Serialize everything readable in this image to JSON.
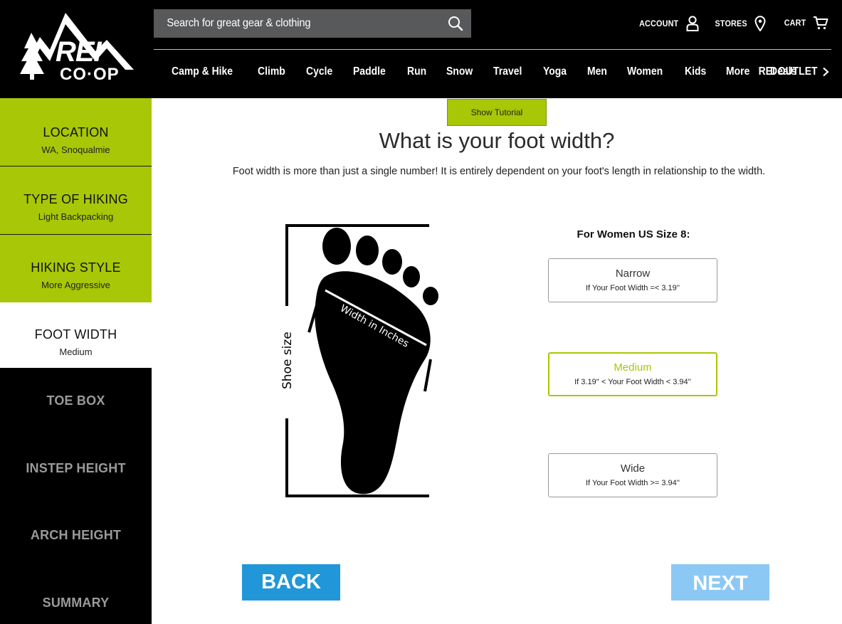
{
  "header": {
    "logo_text_top": "REI",
    "logo_text_bottom": "CO·OP",
    "search_placeholder": "Search for great gear & clothing",
    "account_label": "ACCOUNT",
    "stores_label": "STORES",
    "cart_label": "CART",
    "nav": [
      "Camp & Hike",
      "Climb",
      "Cycle",
      "Paddle",
      "Run",
      "Snow",
      "Travel",
      "Yoga",
      "Men",
      "Women",
      "Kids",
      "More",
      "Deals"
    ],
    "outlet_label": "REI OUTLET"
  },
  "sidebar": {
    "steps": [
      {
        "title": "LOCATION",
        "value": "WA, Snoqualmie",
        "state": "done"
      },
      {
        "title": "TYPE OF HIKING",
        "value": "Light Backpacking",
        "state": "done"
      },
      {
        "title": "HIKING STYLE",
        "value": "More Aggressive",
        "state": "done"
      },
      {
        "title": "FOOT WIDTH",
        "value": "Medium",
        "state": "active"
      },
      {
        "title": "TOE BOX",
        "value": "",
        "state": "future"
      },
      {
        "title": "INSTEP HEIGHT",
        "value": "",
        "state": "future"
      },
      {
        "title": "ARCH HEIGHT",
        "value": "",
        "state": "future"
      },
      {
        "title": "SUMMARY",
        "value": "",
        "state": "future"
      }
    ]
  },
  "main": {
    "tutorial_label": "Show Tutorial",
    "question": "What is your foot width?",
    "subtext": "Foot width is more than just a single number! It is entirely dependent on your foot's length in relationship to the width.",
    "diagram": {
      "width_label": "Width in Inches",
      "length_label": "Shoe size"
    },
    "size_label": "For Women US Size 8:",
    "options": [
      {
        "name": "Narrow",
        "range": "If Your Foot Width =< 3.19''",
        "selected": false
      },
      {
        "name": "Medium",
        "range": "If 3.19'' < Your Foot Width < 3.94''",
        "selected": true
      },
      {
        "name": "Wide",
        "range": "If Your Foot Width >= 3.94''",
        "selected": false
      }
    ],
    "back_label": "BACK",
    "next_label": "NEXT"
  },
  "colors": {
    "accent_green": "#a8c706",
    "back_blue": "#2196d8",
    "next_blue_disabled": "#8cc8f4",
    "header_black": "#000000"
  }
}
